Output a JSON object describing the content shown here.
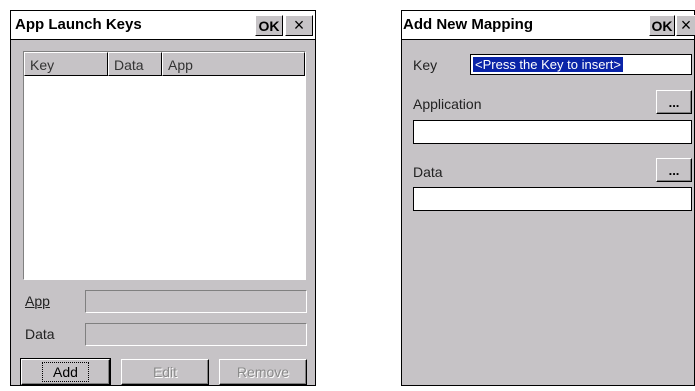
{
  "left_window": {
    "title": "App Launch Keys",
    "ok_label": "OK",
    "close_glyph": "×",
    "list_columns": [
      "Key",
      "Data",
      "App"
    ],
    "app_label": "App",
    "data_label": "Data",
    "add_label": "Add",
    "edit_label": "Edit",
    "remove_label": "Remove"
  },
  "right_window": {
    "title": "Add New Mapping",
    "ok_label": "OK",
    "close_glyph": "×",
    "key_label": "Key",
    "key_value": "<Press the Key to insert>",
    "application_label": "Application",
    "application_value": "",
    "browse_glyph": "...",
    "data_label": "Data",
    "data_value": ""
  },
  "icons": {
    "close": "close-icon",
    "browse": "ellipsis-icon"
  }
}
